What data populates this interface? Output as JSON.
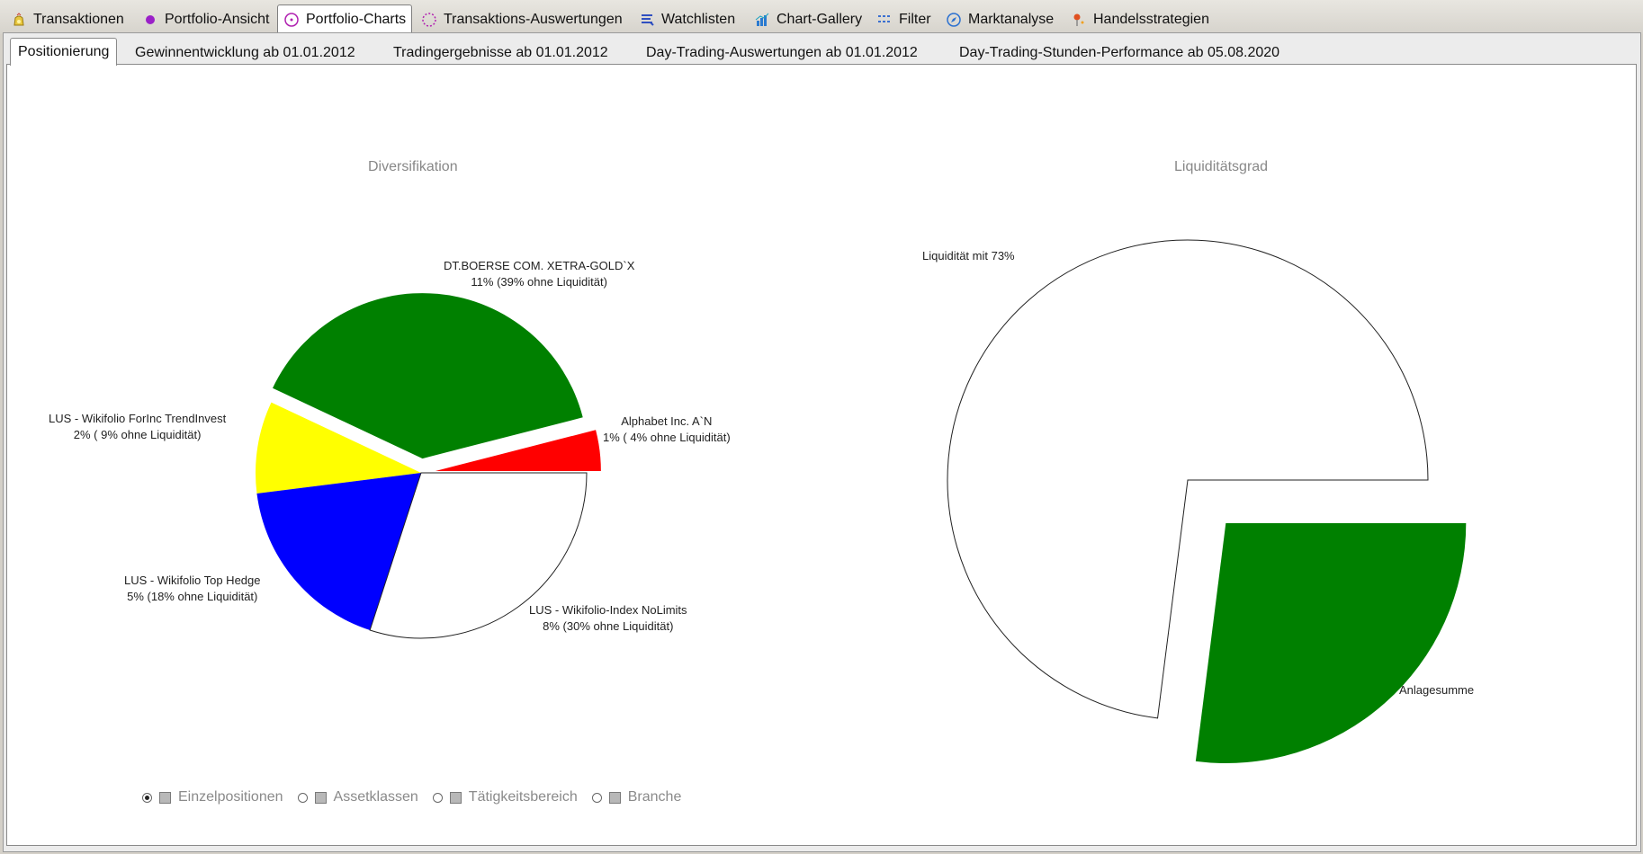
{
  "top_tabs": [
    {
      "label": "Transaktionen",
      "icon": "coin-bag-icon"
    },
    {
      "label": "Portfolio-Ansicht",
      "icon": "purple-dot-icon"
    },
    {
      "label": "Portfolio-Charts",
      "icon": "pie-circle-icon"
    },
    {
      "label": "Transaktions-Auswertungen",
      "icon": "dashed-circle-icon"
    },
    {
      "label": "Watchlisten",
      "icon": "list-icon"
    },
    {
      "label": "Chart-Gallery",
      "icon": "bar-chart-icon"
    },
    {
      "label": "Filter",
      "icon": "filter-icon"
    },
    {
      "label": "Marktanalyse",
      "icon": "compass-icon"
    },
    {
      "label": "Handelsstrategien",
      "icon": "pin-icon"
    }
  ],
  "active_top_tab": "Portfolio-Charts",
  "sub_tabs": [
    {
      "label": "Positionierung"
    },
    {
      "label": "Gewinnentwicklung ab 01.01.2012"
    },
    {
      "label": "Tradingergebnisse ab 01.01.2012"
    },
    {
      "label": "Day-Trading-Auswertungen ab 01.01.2012"
    },
    {
      "label": "Day-Trading-Stunden-Performance ab 05.08.2020"
    }
  ],
  "active_sub_tab": "Positionierung",
  "options": [
    {
      "label": "Einzelpositionen",
      "checked": true
    },
    {
      "label": "Assetklassen",
      "checked": false
    },
    {
      "label": "Tätigkeitsbereich",
      "checked": false
    },
    {
      "label": "Branche",
      "checked": false
    }
  ],
  "chart_data": [
    {
      "type": "pie",
      "title": "Diversifikation",
      "slices": [
        {
          "name": "Alphabet Inc. A`N",
          "label_line1": "Alphabet Inc. A`N",
          "label_line2": "1% ( 4% ohne Liquidität)",
          "value": 4,
          "color": "#ff0000",
          "exploded": true
        },
        {
          "name": "DT.BOERSE COM. XETRA-GOLD`X",
          "label_line1": "DT.BOERSE COM. XETRA-GOLD`X",
          "label_line2": "11% (39% ohne Liquidität)",
          "value": 39,
          "color": "#008000",
          "exploded": true
        },
        {
          "name": "LUS - Wikifolio ForInc TrendInvest",
          "label_line1": "LUS - Wikifolio ForInc TrendInvest",
          "label_line2": "2% ( 9% ohne Liquidität)",
          "value": 9,
          "color": "#ffff00",
          "exploded": false
        },
        {
          "name": "LUS - Wikifolio Top Hedge",
          "label_line1": "LUS - Wikifolio Top Hedge",
          "label_line2": "5% (18% ohne Liquidität)",
          "value": 18,
          "color": "#0000ff",
          "exploded": false
        },
        {
          "name": "LUS - Wikifolio-Index NoLimits",
          "label_line1": "LUS - Wikifolio-Index NoLimits",
          "label_line2": "8% (30% ohne Liquidität)",
          "value": 30,
          "color": "#ffffff",
          "exploded": false
        }
      ]
    },
    {
      "type": "pie",
      "title": "Liquiditätsgrad",
      "slices": [
        {
          "name": "Liquidität",
          "label_line1": "Liquidität mit 73%",
          "value": 73,
          "color": "#ffffff",
          "exploded": false
        },
        {
          "name": "Anlagesumme",
          "label_line1": "Anlagesumme",
          "value": 27,
          "color": "#008000",
          "exploded": true
        }
      ]
    }
  ]
}
